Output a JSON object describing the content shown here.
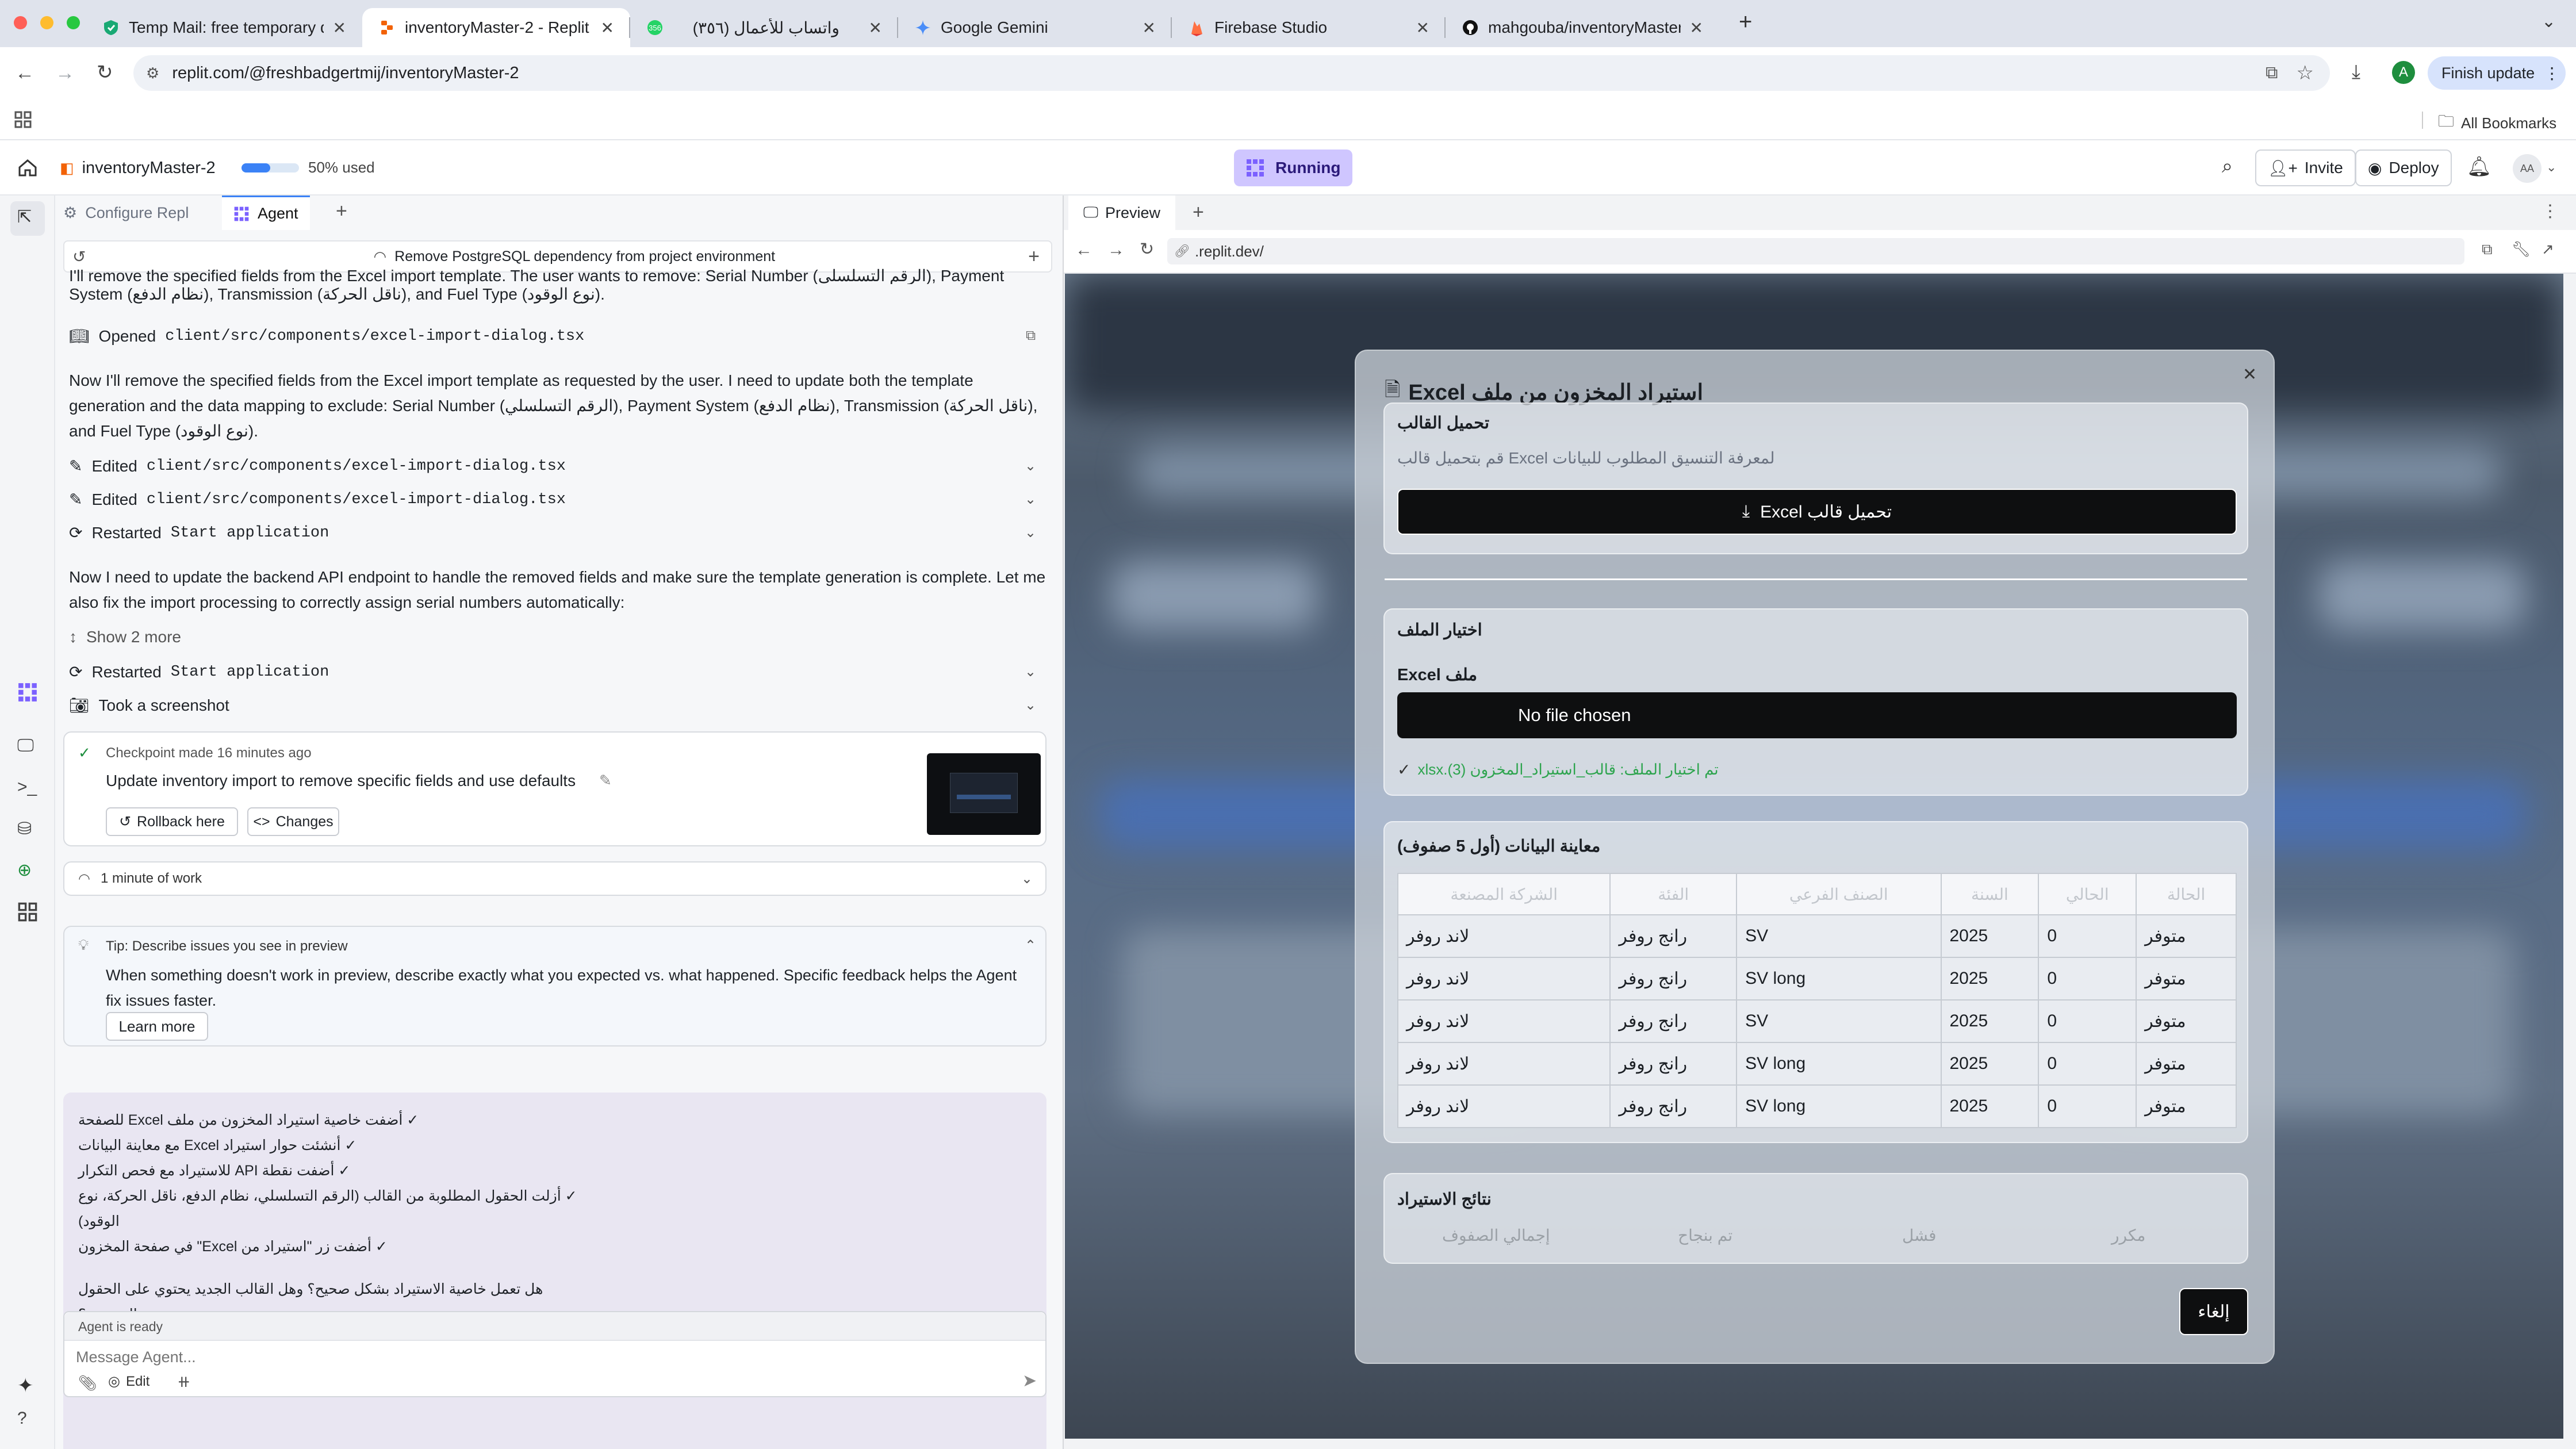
{
  "browser": {
    "tabs": [
      {
        "title": "Temp Mail: free temporary di"
      },
      {
        "title": "inventoryMaster-2 - Replit",
        "active": true
      },
      {
        "title": "(٣٥٦) واتساب للأعمال"
      },
      {
        "title": "Google Gemini"
      },
      {
        "title": "Firebase Studio"
      },
      {
        "title": "mahgouba/inventoryMaster-2"
      }
    ],
    "new_tab": "+",
    "url": "replit.com/@freshbadgertmij/inventoryMaster-2",
    "profile_initial": "A",
    "finish_update": "Finish update",
    "all_bookmarks": "All Bookmarks"
  },
  "replit": {
    "project_name": "inventoryMaster-2",
    "usage_label": "50% used",
    "usage_fraction": 0.5,
    "run_status": "Running",
    "invite": "Invite",
    "deploy": "Deploy",
    "avatar": "AA"
  },
  "left_panel": {
    "tabs": {
      "configure": "Configure Repl",
      "agent": "Agent"
    },
    "thread_title": "Remove PostgreSQL dependency from project environment",
    "intro_line1": "I'll remove the specified fields from the Excel import template. The user wants to remove: Serial Number (الرقم التسلسلي), Payment",
    "intro_line2": "System (نظام الدفع), Transmission (ناقل الحركة), and Fuel Type (نوع الوقود).",
    "opened_label": "Opened",
    "opened_file": "client/src/components/excel-import-dialog.tsx",
    "para1": "Now I'll remove the specified fields from the Excel import template as requested by the user. I need to update both the template generation and the data mapping to exclude: Serial Number (الرقم التسلسلي), Payment System (نظام الدفع), Transmission (ناقل الحركة), and Fuel Type (نوع الوقود).",
    "edited_label": "Edited",
    "edited_file": "client/src/components/excel-import-dialog.tsx",
    "restarted_label": "Restarted",
    "restarted_target": "Start application",
    "para2": "Now I need to update the backend API endpoint to handle the removed fields and make sure the template generation is complete. Let me also fix the import processing to correctly assign serial numbers automatically:",
    "show_more": "Show 2 more",
    "screenshot": "Took a screenshot",
    "checkpoint": {
      "meta": "Checkpoint made 16 minutes ago",
      "title": "Update inventory import to remove specific fields and use defaults",
      "rollback": "Rollback here",
      "changes": "Changes"
    },
    "work": "1 minute of work",
    "tip": {
      "head": "Tip: Describe issues you see in preview",
      "body": "When something doesn't work in preview, describe exactly what you expected vs. what happened. Specific feedback helps the Agent fix issues faster.",
      "learn": "Learn more"
    },
    "summary": [
      "✓ أضفت خاصية استيراد المخزون من ملف Excel للصفحة",
      "✓ أنشئت حوار استيراد Excel مع معاينة البيانات",
      "✓ أضفت نقطة API للاستيراد مع فحص التكرار",
      "✓ أزلت الحقول المطلوبة من القالب (الرقم التسلسلي، نظام الدفع، ناقل الحركة، نوع الوقود)",
      "✓ أضفت زر \"استيراد من Excel\" في صفحة المخزون"
    ],
    "question": "هل تعمل خاصية الاستيراد بشكل صحيح؟ وهل القالب الجديد يحتوي على الحقول الصحيحة؟",
    "agent_ready": "Agent is ready",
    "message_placeholder": "Message Agent...",
    "edit": "Edit"
  },
  "right_panel": {
    "tab": "Preview",
    "url": ".replit.dev/"
  },
  "modal": {
    "title": "استيراد المخزون من ملف Excel",
    "template_section": {
      "title": "تحميل القالب",
      "desc": "لمعرفة التنسيق المطلوب للبيانات Excel قم بتحميل قالب",
      "button": "تحميل قالب Excel"
    },
    "file_section": {
      "title": "اختيار الملف",
      "label": "ملف Excel",
      "no_file": "No file chosen",
      "status": "تم اختيار الملف: قالب_استيراد_المخزون (3).xlsx"
    },
    "preview_section": {
      "title": "معاينة البيانات (أول 5 صفوف)",
      "headers": [
        "الحالة",
        "الحالي",
        "السنة",
        "الصنف الفرعي",
        "الفئة",
        "الشركة المصنعة"
      ],
      "rows": [
        [
          "متوفر",
          "0",
          "2025",
          "SV",
          "رانج روفر",
          "لاند روفر"
        ],
        [
          "متوفر",
          "0",
          "2025",
          "SV long",
          "رانج روفر",
          "لاند روفر"
        ],
        [
          "متوفر",
          "0",
          "2025",
          "SV",
          "رانج روفر",
          "لاند روفر"
        ],
        [
          "متوفر",
          "0",
          "2025",
          "SV long",
          "رانج روفر",
          "لاند روفر"
        ],
        [
          "متوفر",
          "0",
          "2025",
          "SV long",
          "رانج روفر",
          "لاند روفر"
        ]
      ]
    },
    "results_section": {
      "title": "نتائج الاستيراد",
      "labels": [
        "مكرر",
        "فشل",
        "تم بنجاح",
        "إجمالي الصفوف"
      ]
    },
    "cancel": "إلغاء"
  },
  "colors": {
    "accent": "#7b61ff",
    "running_bg": "#cfc6ff",
    "black": "#0e0f10",
    "green": "#2da44e"
  }
}
